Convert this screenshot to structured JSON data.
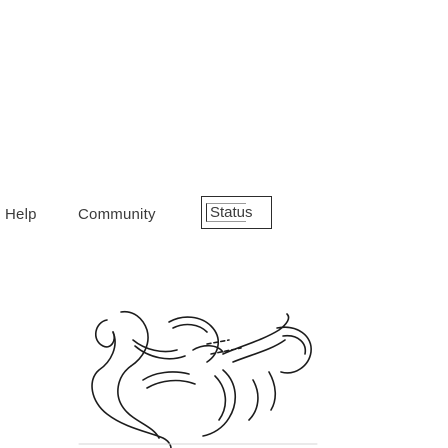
{
  "nav": {
    "help_label": "Help",
    "community_label": "Community",
    "status_label": "Status"
  },
  "illustration": {
    "icon": "line-art-illustration"
  },
  "colors": {
    "background": "#ffffff",
    "text": "#3b3b3b",
    "outline": "#2c2c2c"
  }
}
